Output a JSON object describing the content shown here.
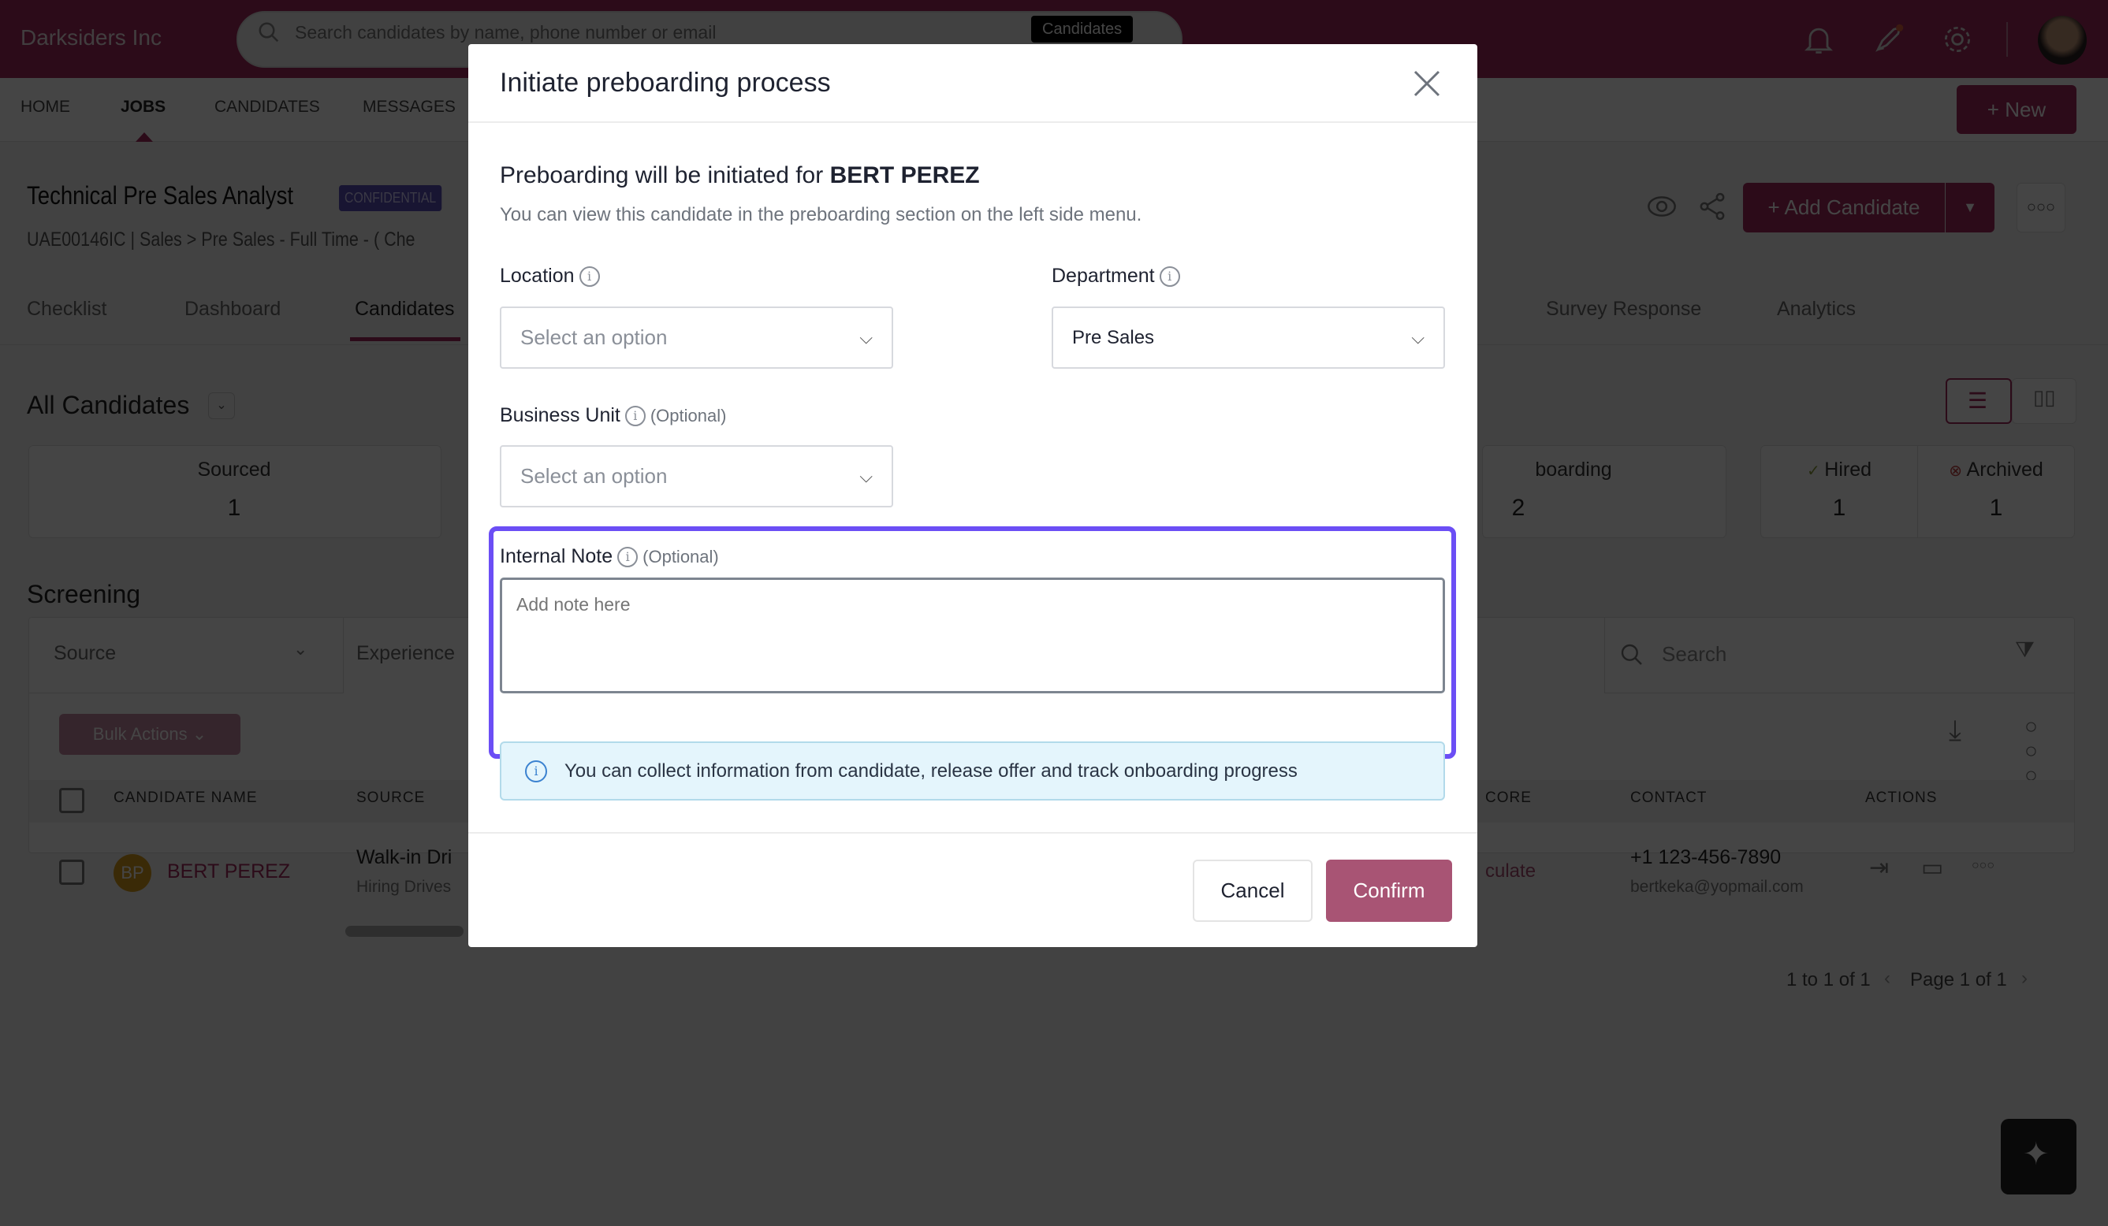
{
  "topbar": {
    "logo": "Darksiders Inc",
    "search_placeholder": "Search candidates by name, phone number or email",
    "search_scope": "Candidates"
  },
  "nav": {
    "items": [
      "HOME",
      "JOBS",
      "CANDIDATES",
      "MESSAGES"
    ],
    "active": "JOBS",
    "new_button": "+ New"
  },
  "job": {
    "title": "Technical Pre Sales Analyst",
    "badge": "CONFIDENTIAL",
    "subtitle": "UAE00146IC | Sales > Pre Sales - Full Time - ( Che",
    "add_candidate": "+ Add Candidate"
  },
  "tabs": [
    "Checklist",
    "Dashboard",
    "Candidates",
    "Survey Response",
    "Analytics"
  ],
  "candidates": {
    "view_title": "All Candidates",
    "stages": [
      {
        "label": "Sourced",
        "count": "1"
      },
      {
        "label": "boarding",
        "count": "2"
      },
      {
        "label": "Hired",
        "count": "1"
      },
      {
        "label": "Archived",
        "count": "1"
      }
    ],
    "section": "Screening",
    "filters": {
      "source": "Source",
      "experience": "Experience",
      "search_placeholder": "Search"
    },
    "bulk_actions": "Bulk Actions",
    "columns": [
      "CANDIDATE NAME",
      "SOURCE",
      "CORE",
      "CONTACT",
      "ACTIONS"
    ],
    "rows": [
      {
        "initials": "BP",
        "name": "BERT PEREZ",
        "source": "Walk-in Dri",
        "source_sub": "Hiring Drives",
        "score": "culate",
        "phone": "+1 123-456-7890",
        "email": "bertkeka@yopmail.com"
      }
    ],
    "pagination": {
      "range": "1 to 1 of 1",
      "page": "Page 1 of 1"
    }
  },
  "modal": {
    "title": "Initiate preboarding process",
    "intro_prefix": "Preboarding will be initiated for ",
    "candidate_name": "BERT PEREZ",
    "intro_sub": "You can view this candidate in the preboarding section on the left side menu.",
    "location_label": "Location",
    "location_placeholder": "Select an option",
    "department_label": "Department",
    "department_value": "Pre Sales",
    "business_unit_label": "Business Unit",
    "optional": "(Optional)",
    "business_unit_placeholder": "Select an option",
    "note_label": "Internal Note",
    "note_placeholder": "Add note here",
    "info_text": "You can collect information from candidate, release offer and track onboarding progress",
    "cancel": "Cancel",
    "confirm": "Confirm"
  },
  "colors": {
    "brand": "#7a1f45",
    "confirm": "#a85474",
    "highlight": "#6b4ef5",
    "info_bg": "#e4f5fc"
  }
}
